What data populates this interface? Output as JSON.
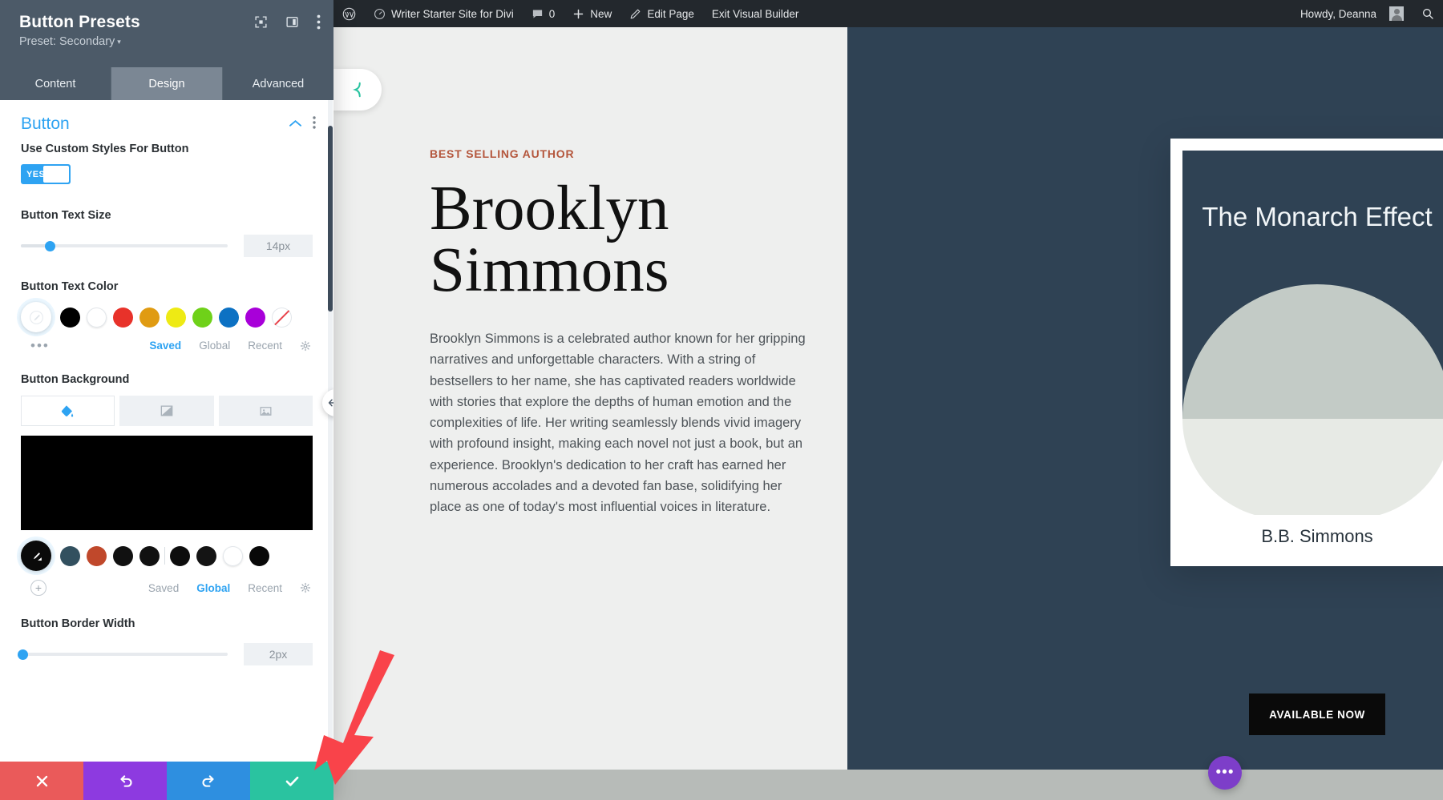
{
  "panel": {
    "title": "Button Presets",
    "preset_label": "Preset: Secondary",
    "caret": "▾",
    "head_icons": [
      "focus-icon",
      "layout-icon",
      "more-vertical-icon"
    ],
    "tabs": [
      {
        "label": "Content",
        "active": false
      },
      {
        "label": "Design",
        "active": true
      },
      {
        "label": "Advanced",
        "active": false
      }
    ],
    "group": {
      "title": "Button",
      "collapse_icon": "chevron-up-icon",
      "more_icon": "more-vertical-icon"
    },
    "fields": {
      "custom_styles": {
        "label": "Use Custom Styles For Button",
        "toggle_value": "YES"
      },
      "text_size": {
        "label": "Button Text Size",
        "value": "14px",
        "slider_percent": 14
      },
      "text_color": {
        "label": "Button Text Color",
        "swatches": [
          "#000000",
          "#ffffff",
          "#e8322a",
          "#e09b12",
          "#eeea14",
          "#6fd119",
          "#0c71c3",
          "#a800d9",
          "clear"
        ],
        "picker": "eyedropper-icon",
        "links": [
          {
            "label": "Saved",
            "active": true
          },
          {
            "label": "Global",
            "active": false
          },
          {
            "label": "Recent",
            "active": false
          }
        ],
        "gear": "gear-icon",
        "dots": "•••"
      },
      "background": {
        "label": "Button Background",
        "tabs": [
          {
            "icon": "paint-bucket-icon",
            "active": true
          },
          {
            "icon": "gradient-icon",
            "active": false
          },
          {
            "icon": "image-icon",
            "active": false
          }
        ],
        "preview_color": "#000000",
        "swatches": [
          "#32505f",
          "#c0482b",
          "#111111",
          "#111111",
          "#0d0d0d",
          "#141414",
          "#ffffff",
          "#080808"
        ],
        "picker": "eyedropper-icon",
        "add": "+",
        "links": [
          {
            "label": "Saved",
            "active": false
          },
          {
            "label": "Global",
            "active": true
          },
          {
            "label": "Recent",
            "active": false
          }
        ],
        "gear": "gear-icon"
      },
      "border_width": {
        "label": "Button Border Width",
        "value": "2px",
        "slider_percent": 2
      }
    },
    "actions": [
      {
        "name": "cancel",
        "icon": "close-icon",
        "color": "#ea5a5a"
      },
      {
        "name": "undo",
        "icon": "undo-icon",
        "color": "#8d3ae0"
      },
      {
        "name": "redo",
        "icon": "redo-icon",
        "color": "#2e8fe0"
      },
      {
        "name": "save",
        "icon": "check-icon",
        "color": "#2ac3a0"
      }
    ],
    "resize_handle_icon": "horizontal-resize-icon"
  },
  "adminbar": {
    "wp_logo": "wordpress-icon",
    "dashboard_icon": "dashboard-icon",
    "site_name": "Writer Starter Site for Divi",
    "comments_icon": "comment-icon",
    "comments_count": "0",
    "new_icon": "plus-icon",
    "new_label": "New",
    "edit_icon": "pencil-icon",
    "edit_label": "Edit Page",
    "exit_label": "Exit Visual Builder",
    "howdy": "Howdy, Deanna",
    "avatar": "avatar",
    "search_icon": "search-icon"
  },
  "canvas": {
    "divi_logo": "divi-logo-icon",
    "eyebrow": "BEST SELLING AUTHOR",
    "heading": "Brooklyn Simmons",
    "paragraph": "Brooklyn Simmons is a celebrated author known for her gripping narratives and unforgettable characters. With a string of bestsellers to her name, she has captivated readers worldwide with stories that explore the depths of human emotion and the complexities of life. Her writing seamlessly blends vivid imagery with profound insight, making each novel not just a book, but an experience. Brooklyn's dedication to her craft has earned her numerous accolades and a devoted fan base, solidifying her place as one of today's most influential voices in literature.",
    "book": {
      "title": "The Monarch Effect",
      "author": "B.B. Simmons",
      "cover_bg": "#2f4254",
      "petal_color": "#c3cbc6",
      "petal_color_light": "#e7eae5"
    },
    "cta_label": "AVAILABLE NOW",
    "fab_icon": "more-horizontal-icon",
    "hero_bg": "#2f4254"
  },
  "annotation": {
    "arrow_color": "#f9434a"
  }
}
